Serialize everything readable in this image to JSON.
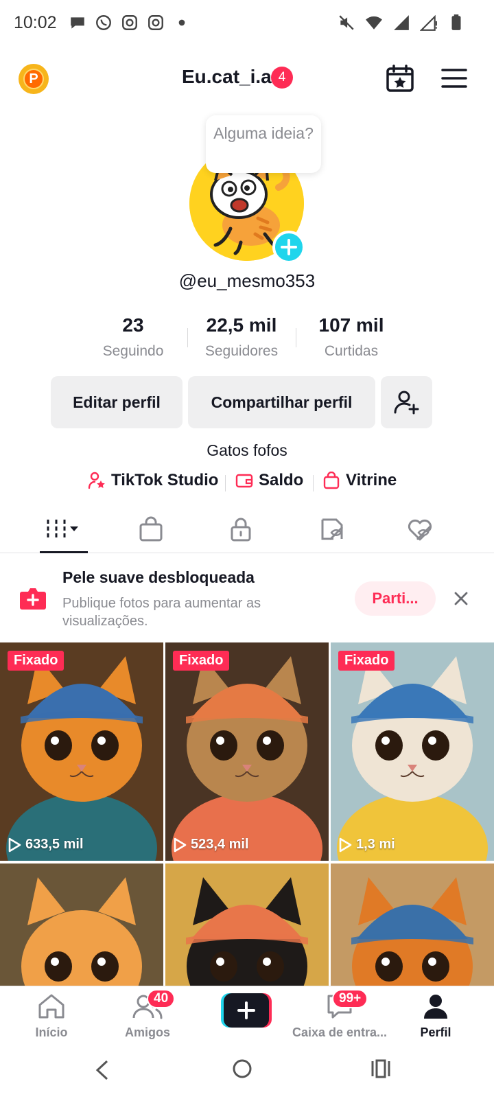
{
  "status_bar": {
    "time": "10:02"
  },
  "header": {
    "title": "Eu.cat_i.a",
    "notif_count": "4",
    "coin_letter": "P"
  },
  "profile": {
    "tooltip": "Alguma ideia?",
    "handle": "@eu_mesmo353",
    "stats": [
      {
        "value": "23",
        "label": "Seguindo"
      },
      {
        "value": "22,5 mil",
        "label": "Seguidores"
      },
      {
        "value": "107 mil",
        "label": "Curtidas"
      }
    ],
    "edit_label": "Editar perfil",
    "share_label": "Compartilhar perfil",
    "bio": "Gatos fofos",
    "links": [
      {
        "label": "TikTok Studio",
        "icon": "person-star-icon"
      },
      {
        "label": "Saldo",
        "icon": "wallet-icon"
      },
      {
        "label": "Vitrine",
        "icon": "shopping-bag-icon"
      }
    ]
  },
  "tabs": [
    "videos-grid-icon",
    "shop-bag-icon",
    "lock-icon",
    "repost-icon",
    "liked-heart-icon"
  ],
  "banner": {
    "title": "Pele suave desbloqueada",
    "description": "Publique fotos para aumentar as visualizações.",
    "cta": "Parti..."
  },
  "videos": [
    {
      "pinned": "Fixado",
      "views": "633,5 mil",
      "fur": "#e88a2a",
      "shirt": "#2a6f78",
      "cap": "#3a6fae",
      "bg": "#5a3c22"
    },
    {
      "pinned": "Fixado",
      "views": "523,4 mil",
      "fur": "#b9864e",
      "shirt": "#e8704c",
      "cap": "#e57a44",
      "bg": "#4a3424"
    },
    {
      "pinned": "Fixado",
      "views": "1,3 mi",
      "fur": "#efe4d4",
      "shirt": "#f0c43a",
      "cap": "#3a78b8",
      "bg": "#a9c3c8"
    },
    {
      "pinned": "",
      "views": "",
      "fur": "#f0a048",
      "shirt": "#f0a048",
      "cap": "",
      "bg": "#6a5638"
    },
    {
      "pinned": "",
      "views": "",
      "fur": "#1e1a18",
      "shirt": "#1e1a18",
      "cap": "#e8764a",
      "bg": "#d6a648"
    },
    {
      "pinned": "",
      "views": "",
      "fur": "#e07a26",
      "shirt": "#e07a26",
      "cap": "#3a70a8",
      "bg": "#c49a64"
    }
  ],
  "bottom_nav": {
    "home": "Início",
    "friends": "Amigos",
    "friends_badge": "40",
    "inbox": "Caixa de entra...",
    "inbox_badge": "99+",
    "profile": "Perfil"
  },
  "colors": {
    "accent": "#fe2c55",
    "cyan": "#20d5ec",
    "gray_text": "#8a8b91"
  }
}
